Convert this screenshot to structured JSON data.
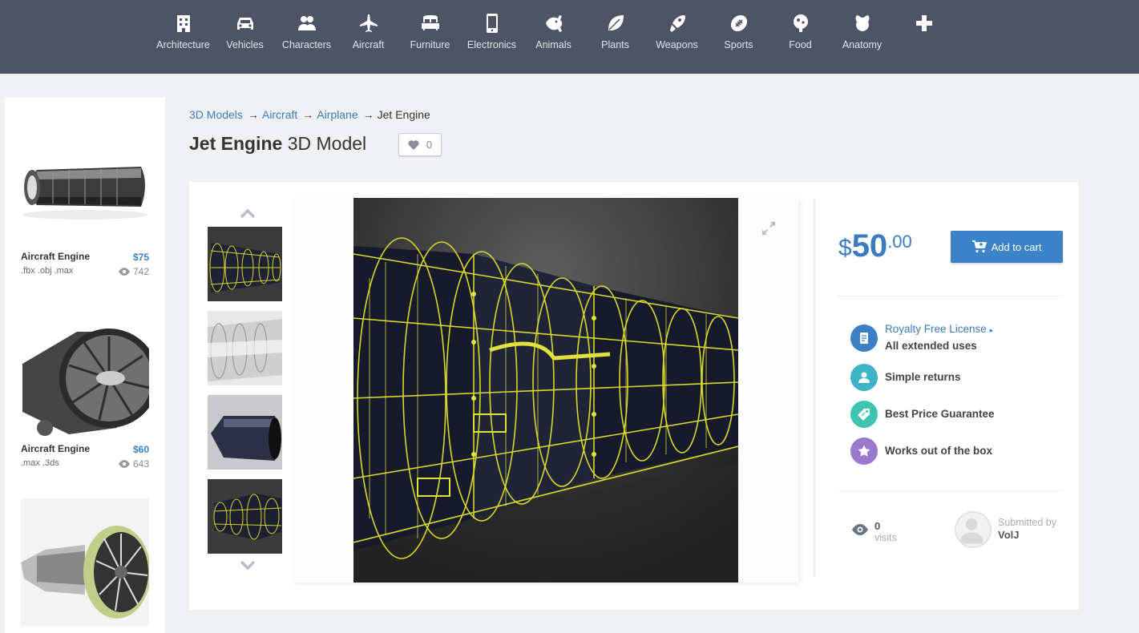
{
  "nav": {
    "items": [
      {
        "label": "Architecture",
        "icon": "building-icon"
      },
      {
        "label": "Vehicles",
        "icon": "car-icon"
      },
      {
        "label": "Characters",
        "icon": "people-icon"
      },
      {
        "label": "Aircraft",
        "icon": "plane-icon"
      },
      {
        "label": "Furniture",
        "icon": "bed-icon"
      },
      {
        "label": "Electronics",
        "icon": "phone-icon"
      },
      {
        "label": "Animals",
        "icon": "fish-icon"
      },
      {
        "label": "Plants",
        "icon": "leaf-icon"
      },
      {
        "label": "Weapons",
        "icon": "rocket-icon"
      },
      {
        "label": "Sports",
        "icon": "football-icon"
      },
      {
        "label": "Food",
        "icon": "food-icon"
      },
      {
        "label": "Anatomy",
        "icon": "anatomy-icon"
      }
    ],
    "more_icon": "plus-icon"
  },
  "sidebar": {
    "items": [
      {
        "title": "Aircraft Engine",
        "price": "$75",
        "formats": ".fbx .obj .max",
        "views": "742"
      },
      {
        "title": "Aircraft Engine",
        "price": "$60",
        "formats": ".max .3ds",
        "views": "643"
      },
      {
        "title": "",
        "price": "",
        "formats": "",
        "views": ""
      }
    ]
  },
  "breadcrumb": {
    "items": [
      "3D Models",
      "Aircraft",
      "Airplane"
    ],
    "current": "Jet Engine",
    "separator": "→"
  },
  "title": {
    "name": "Jet Engine",
    "suffix": "3D Model",
    "likes": "0"
  },
  "price": {
    "currency": "$",
    "whole": "50",
    "cents": ".00"
  },
  "cart": {
    "label": "Add to cart"
  },
  "features": {
    "license_link": "Royalty Free License",
    "license_sub": "All extended uses",
    "returns": "Simple returns",
    "guarantee": "Best Price Guarantee",
    "works": "Works out of the box"
  },
  "stats": {
    "visits_count": "0",
    "visits_label": "visits",
    "submitted_label": "Submitted by",
    "author": "VolJ"
  },
  "colors": {
    "nav_bg": "#4d5466",
    "accent": "#3b7bbf",
    "button": "#3b82c8",
    "license_icon": "#3b7fc4",
    "returns_icon": "#3fb3c7",
    "guarantee_icon": "#3ec4b0",
    "works_icon": "#9a79cf"
  }
}
